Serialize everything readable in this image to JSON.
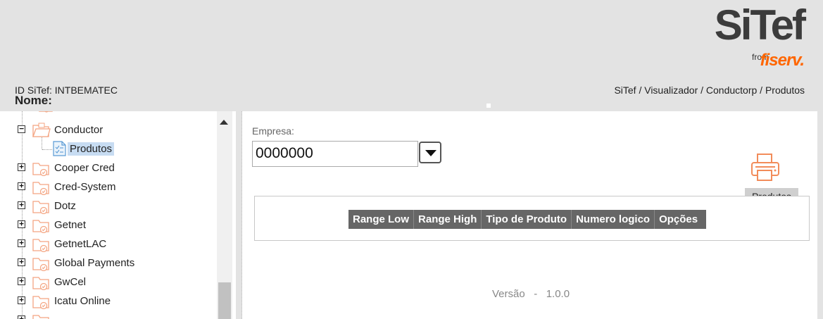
{
  "header": {
    "logo_main": "SiTef",
    "logo_from": "from",
    "logo_brand": "fiserv.",
    "id_label": "ID SiTef: INTBEMATEC",
    "nome_label": "Nome:",
    "breadcrumb": "SiTef / Visualizador / Conductorp / Produtos"
  },
  "sidebar": {
    "tree": [
      {
        "label": "Conductor",
        "expanded": true
      },
      {
        "label": "Produtos",
        "selected": true,
        "child": true
      },
      {
        "label": "Cooper Cred"
      },
      {
        "label": "Cred-System"
      },
      {
        "label": "Dotz"
      },
      {
        "label": "Getnet"
      },
      {
        "label": "GetnetLAC"
      },
      {
        "label": "Global Payments"
      },
      {
        "label": "GwCel"
      },
      {
        "label": "Icatu Online"
      }
    ],
    "collapse_symbol": "−",
    "expand_symbol": "+"
  },
  "main": {
    "empresa_label": "Empresa:",
    "empresa_value": "0000000",
    "print_label": "Produtos",
    "columns": [
      "Range Low",
      "Range High",
      "Tipo de Produto",
      "Numero logico",
      "Opções"
    ],
    "versao": "Versão   -   1.0.0"
  },
  "colors": {
    "accent_orange": "#ff6600",
    "folder_orange": "#f4a582",
    "header_gray": "#e3e3e3",
    "grid_header": "#666666",
    "selection": "#c7dcf2"
  }
}
